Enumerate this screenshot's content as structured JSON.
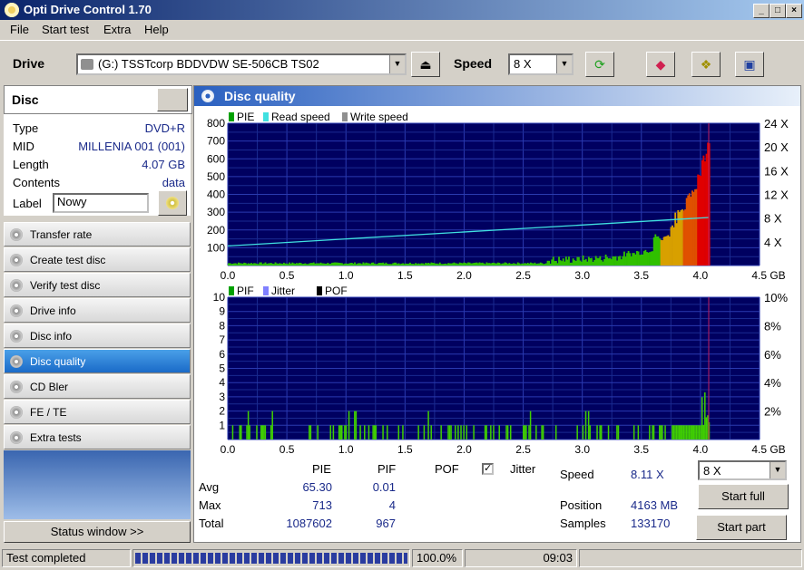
{
  "window": {
    "title": "Opti Drive Control 1.70"
  },
  "menu": [
    "File",
    "Start test",
    "Extra",
    "Help"
  ],
  "toolbar": {
    "drive_label": "Drive",
    "drive_value": "(G:)  TSSTcorp BDDVDW SE-506CB TS02",
    "speed_label": "Speed",
    "speed_value": "8 X"
  },
  "disc": {
    "header": "Disc",
    "rows": [
      {
        "key": "Type",
        "value": "DVD+R"
      },
      {
        "key": "MID",
        "value": "MILLENIA 001 (001)"
      },
      {
        "key": "Length",
        "value": "4.07 GB"
      },
      {
        "key": "Contents",
        "value": "data"
      }
    ],
    "label_key": "Label",
    "label_value": "Nowy"
  },
  "nav": [
    "Transfer rate",
    "Create test disc",
    "Verify test disc",
    "Drive info",
    "Disc info",
    "Disc quality",
    "CD Bler",
    "FE / TE",
    "Extra tests"
  ],
  "nav_active": "Disc quality",
  "status_window_label": "Status window >>",
  "panel": {
    "title": "Disc quality"
  },
  "chart_data": [
    {
      "type": "area",
      "legend": [
        "PIE",
        "Read speed",
        "Write speed"
      ],
      "legend_colors": [
        "#00a000",
        "#40e0e0",
        "#909090"
      ],
      "x_ticks": [
        "0.0",
        "0.5",
        "1.0",
        "1.5",
        "2.0",
        "2.5",
        "3.0",
        "3.5",
        "4.0",
        "4.5 GB"
      ],
      "xlim": [
        0,
        4.5
      ],
      "ylim": [
        0,
        800
      ],
      "y_ticks": [
        "800",
        "700",
        "600",
        "500",
        "400",
        "300",
        "200",
        "100"
      ],
      "y2_ticks": [
        "24 X",
        "20 X",
        "16 X",
        "12 X",
        "8 X",
        "4 X"
      ],
      "y2lim": [
        0,
        24
      ],
      "read_speed": {
        "x": [
          0.0,
          4.07
        ],
        "y": [
          3.3,
          8.1
        ]
      },
      "marker_x": 4.07
    },
    {
      "type": "bar",
      "legend": [
        "PIF",
        "Jitter",
        "POF"
      ],
      "legend_colors": [
        "#00a000",
        "#8080ff",
        "#000000"
      ],
      "x_ticks": [
        "0.0",
        "0.5",
        "1.0",
        "1.5",
        "2.0",
        "2.5",
        "3.0",
        "3.5",
        "4.0",
        "4.5 GB"
      ],
      "xlim": [
        0,
        4.5
      ],
      "ylim": [
        0,
        10
      ],
      "y_ticks": [
        "10",
        "9",
        "8",
        "7",
        "6",
        "5",
        "4",
        "3",
        "2",
        "1"
      ],
      "y2_ticks": [
        "10%",
        "8%",
        "6%",
        "4%",
        "2%"
      ],
      "marker_x": 4.07
    }
  ],
  "stats": {
    "headers": {
      "pie": "PIE",
      "pif": "PIF",
      "pof": "POF",
      "jitter": "Jitter"
    },
    "rows": [
      {
        "label": "Avg",
        "pie": "65.30",
        "pif": "0.01"
      },
      {
        "label": "Max",
        "pie": "713",
        "pif": "4"
      },
      {
        "label": "Total",
        "pie": "1087602",
        "pif": "967"
      }
    ],
    "speed_label": "Speed",
    "speed_value": "8.11 X",
    "position_label": "Position",
    "position_value": "4163 MB",
    "samples_label": "Samples",
    "samples_value": "133170",
    "speed_select": "8 X",
    "start_full": "Start full",
    "start_part": "Start part"
  },
  "statusbar": {
    "text": "Test completed",
    "progress": "100.0%",
    "progress_fraction": 1.0,
    "time": "09:03"
  }
}
